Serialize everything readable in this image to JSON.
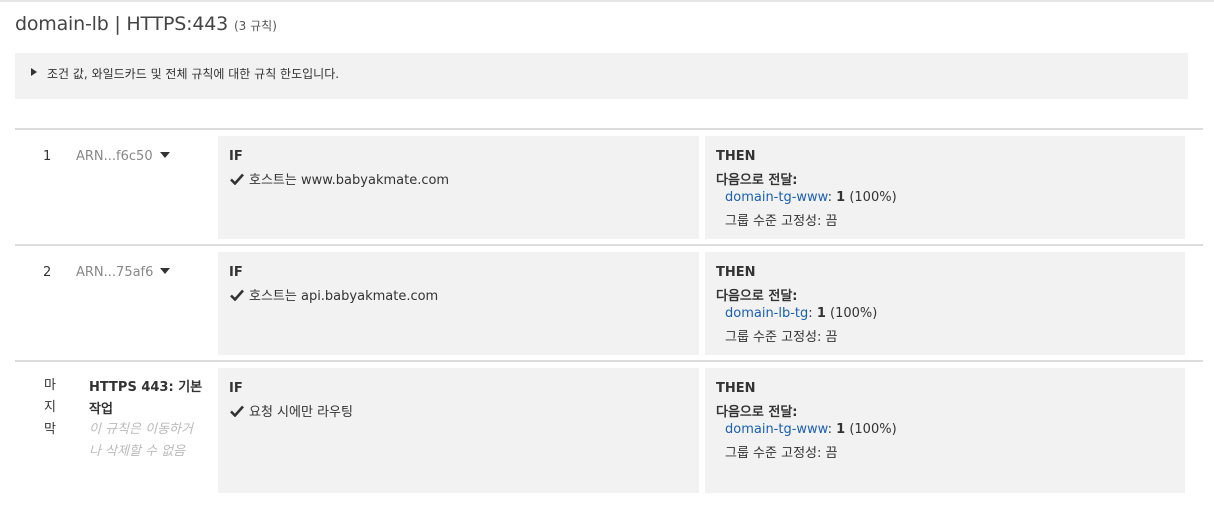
{
  "header": {
    "title": "domain-lb | HTTPS:443",
    "rule_count": "(3 규칙)"
  },
  "info": {
    "text": "조건 값, 와일드카드 및 전체 규칙에 대한 규칙 한도입니다."
  },
  "rules": [
    {
      "number": "1",
      "arn": "ARN...f6c50",
      "if_label": "IF",
      "condition": "호스트는 www.babyakmate.com",
      "then_label": "THEN",
      "forward_label": "다음으로 전달:",
      "target_group": "domain-tg-www",
      "weight_colon": ":",
      "weight": "1",
      "weight_pct": "(100%)",
      "stickiness": "그룹 수준 고정성: 끔"
    },
    {
      "number": "2",
      "arn": "ARN...75af6",
      "if_label": "IF",
      "condition": "호스트는 api.babyakmate.com",
      "then_label": "THEN",
      "forward_label": "다음으로 전달:",
      "target_group": "domain-lb-tg",
      "weight_colon": ":",
      "weight": "1",
      "weight_pct": "(100%)",
      "stickiness": "그룹 수준 고정성: 끔"
    }
  ],
  "default_rule": {
    "number": "마지막",
    "name": "HTTPS 443: 기본 작업",
    "note": "이 규칙은 이동하거나 삭제할 수 없음",
    "if_label": "IF",
    "condition": "요청 시에만 라우팅",
    "then_label": "THEN",
    "forward_label": "다음으로 전달:",
    "target_group": "domain-tg-www",
    "weight_colon": ":",
    "weight": "1",
    "weight_pct": "(100%)",
    "stickiness": "그룹 수준 고정성: 끔"
  },
  "icons": {
    "check": "checkmark-icon",
    "expand": "caret-right-icon",
    "dropdown": "caret-down-icon"
  },
  "colors": {
    "link": "#1a5fb4",
    "panel_bg": "#f2f2f2"
  }
}
